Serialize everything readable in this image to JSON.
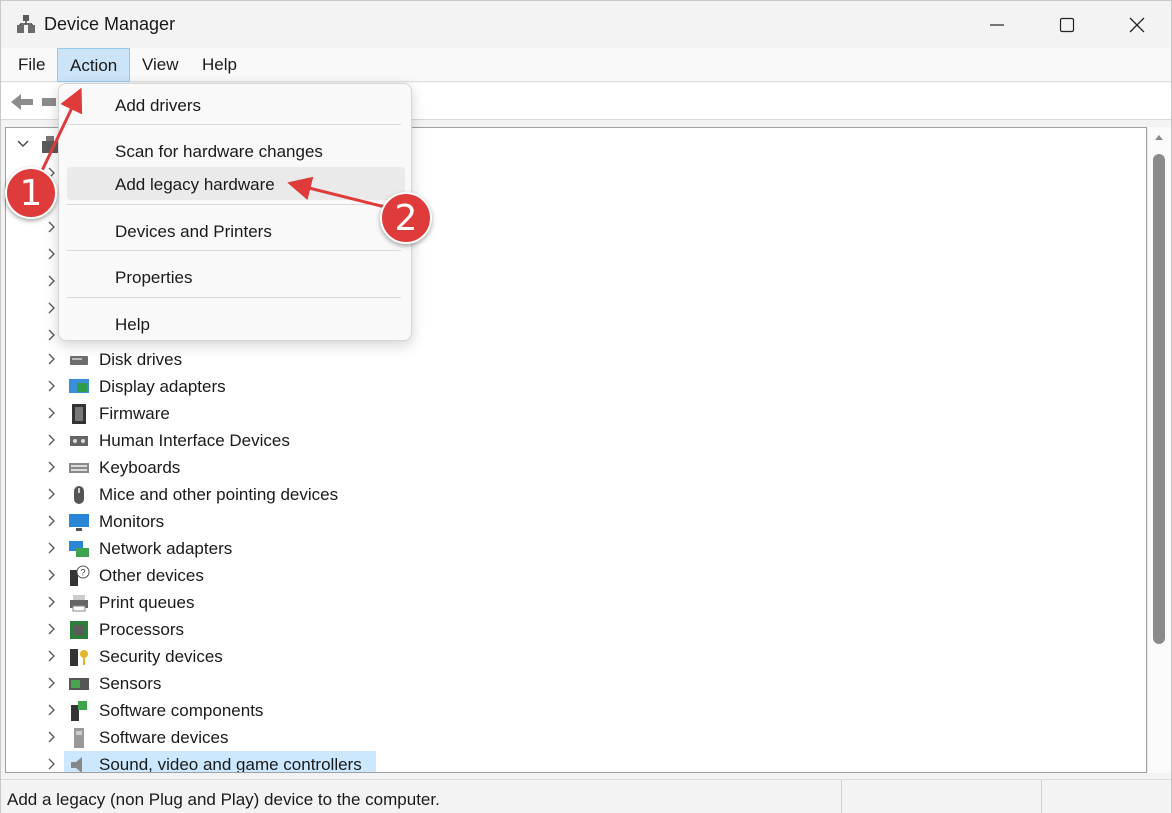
{
  "window": {
    "title": "Device Manager"
  },
  "menubar": {
    "file": "File",
    "action": "Action",
    "view": "View",
    "help": "Help"
  },
  "action_menu": {
    "items": [
      {
        "label": "Add drivers"
      },
      {
        "label": "Scan for hardware changes"
      },
      {
        "label": "Add legacy hardware"
      },
      {
        "label": "Devices and Printers"
      },
      {
        "label": "Properties"
      },
      {
        "label": "Help"
      }
    ],
    "highlighted": "Add legacy hardware"
  },
  "tree": {
    "items": [
      {
        "label": "Disk drives",
        "icon": "disk-drive-icon"
      },
      {
        "label": "Display adapters",
        "icon": "display-adapter-icon"
      },
      {
        "label": "Firmware",
        "icon": "firmware-icon"
      },
      {
        "label": "Human Interface Devices",
        "icon": "hid-icon"
      },
      {
        "label": "Keyboards",
        "icon": "keyboard-icon"
      },
      {
        "label": "Mice and other pointing devices",
        "icon": "mouse-icon"
      },
      {
        "label": "Monitors",
        "icon": "monitor-icon"
      },
      {
        "label": "Network adapters",
        "icon": "network-adapter-icon"
      },
      {
        "label": "Other devices",
        "icon": "other-devices-icon"
      },
      {
        "label": "Print queues",
        "icon": "printer-icon"
      },
      {
        "label": "Processors",
        "icon": "processor-icon"
      },
      {
        "label": "Security devices",
        "icon": "security-device-icon"
      },
      {
        "label": "Sensors",
        "icon": "sensor-icon"
      },
      {
        "label": "Software components",
        "icon": "software-component-icon"
      },
      {
        "label": "Software devices",
        "icon": "software-device-icon"
      },
      {
        "label": "Sound, video and game controllers",
        "icon": "speaker-icon"
      }
    ],
    "selected": "Sound, video and game controllers"
  },
  "statusbar": {
    "text": "Add a legacy (non Plug and Play) device to the computer."
  },
  "annotations": {
    "step1": "1",
    "step2": "2"
  },
  "colors": {
    "menu_active": "#cce4f7",
    "selection": "#cce8ff",
    "annotation": "#e03b3b"
  }
}
